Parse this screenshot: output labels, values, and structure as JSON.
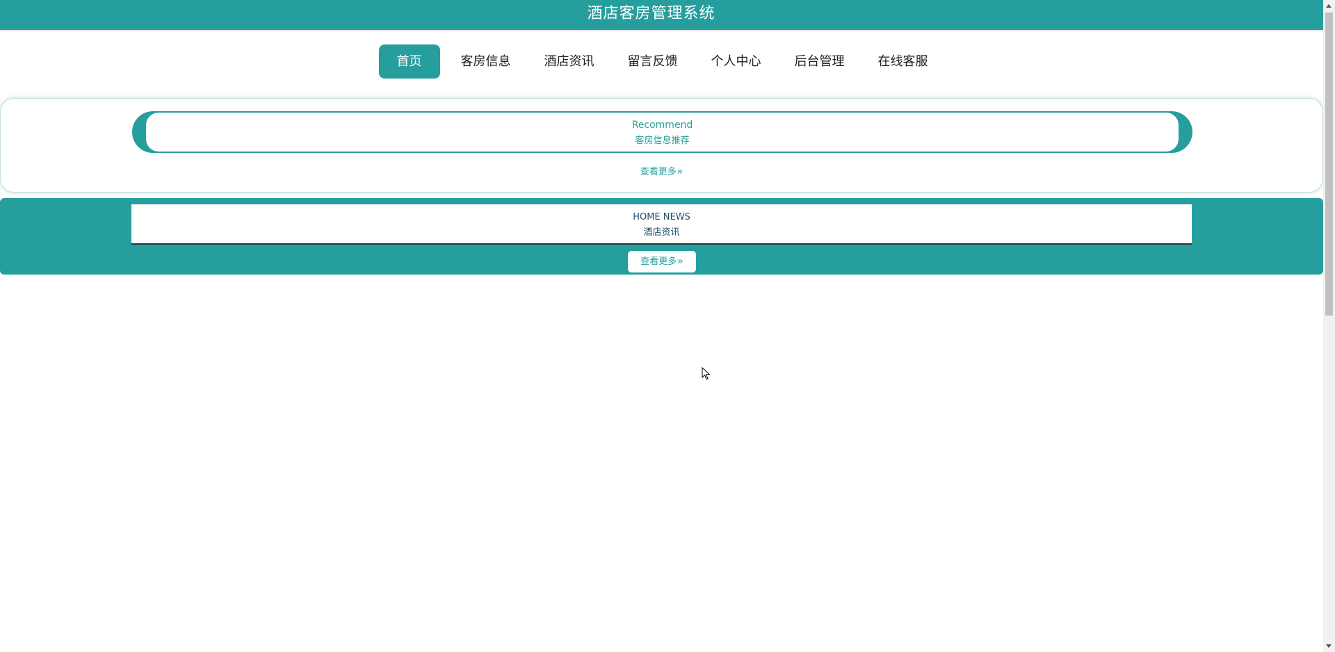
{
  "app": {
    "title": "酒店客房管理系统"
  },
  "nav": {
    "items": [
      {
        "label": "首页",
        "active": true
      },
      {
        "label": "客房信息",
        "active": false
      },
      {
        "label": "酒店资讯",
        "active": false
      },
      {
        "label": "留言反馈",
        "active": false
      },
      {
        "label": "个人中心",
        "active": false
      },
      {
        "label": "后台管理",
        "active": false
      },
      {
        "label": "在线客服",
        "active": false
      }
    ]
  },
  "recommend": {
    "title_en": "Recommend",
    "title_cn": "客房信息推荐",
    "more_label": "查看更多",
    "more_icon": "double-chevron-right-icon"
  },
  "news": {
    "title_en": "HOME NEWS",
    "title_cn": "酒店资讯",
    "more_label": "查看更多",
    "more_icon": "double-chevron-right-icon"
  },
  "colors": {
    "primary": "#279e9e",
    "background": "#ffffff",
    "nav_text": "#222222"
  }
}
